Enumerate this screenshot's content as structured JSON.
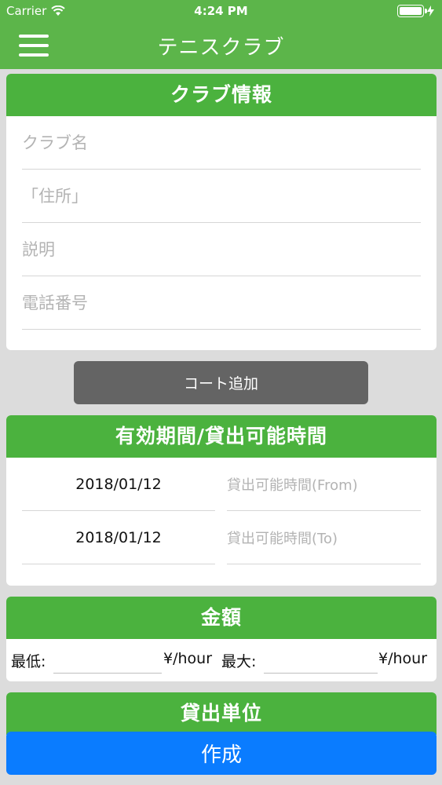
{
  "status_bar": {
    "carrier": "Carrier",
    "time": "4:24 PM"
  },
  "nav": {
    "title": "テニスクラブ"
  },
  "club_info": {
    "header": "クラブ情報",
    "club_name_placeholder": "クラブ名",
    "address_placeholder": "「住所」",
    "description_placeholder": "説明",
    "phone_placeholder": "電話番号"
  },
  "add_court_label": "コート追加",
  "period": {
    "header": "有効期間/貸出可能時間",
    "start_date": "2018/01/12",
    "end_date": "2018/01/12",
    "time_from_placeholder": "貸出可能時間(From)",
    "time_to_placeholder": "貸出可能時間(To)"
  },
  "amount": {
    "header": "金額",
    "min_label": "最低:",
    "max_label": "最大:",
    "unit_min": "¥/hour",
    "unit_max": "¥/hour"
  },
  "rental_unit": {
    "header": "貸出単位"
  },
  "create_label": "作成",
  "colors": {
    "nav_green": "#5cb54a",
    "header_green": "#4bb23e",
    "create_blue": "#0a7cff",
    "court_gray": "#646464"
  }
}
